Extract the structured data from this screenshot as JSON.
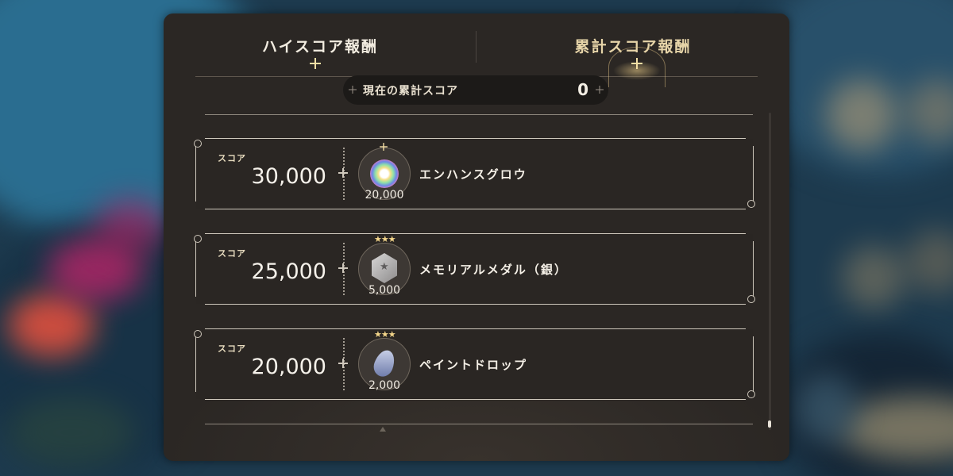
{
  "tabs": {
    "high_score": "ハイスコア報酬",
    "cumulative_score": "累計スコア報酬",
    "active": "high_score"
  },
  "current_total": {
    "label": "現在の累計スコア",
    "value": "0"
  },
  "rewards": [
    {
      "score_label": "スコア",
      "score": "30,000",
      "item_name": "エンハンスグロウ",
      "quantity": "20,000",
      "icon": "rainbow-orb-icon",
      "stars": ""
    },
    {
      "score_label": "スコア",
      "score": "25,000",
      "item_name": "メモリアルメダル（銀）",
      "quantity": "5,000",
      "icon": "silver-medal-icon",
      "stars": "★★★"
    },
    {
      "score_label": "スコア",
      "score": "20,000",
      "item_name": "ペイントドロップ",
      "quantity": "2,000",
      "icon": "paint-drop-icon",
      "stars": "★★★"
    }
  ],
  "colors": {
    "panel": "#2b2724",
    "accent_gold": "#e6d4a8",
    "text": "#f4efe6"
  }
}
